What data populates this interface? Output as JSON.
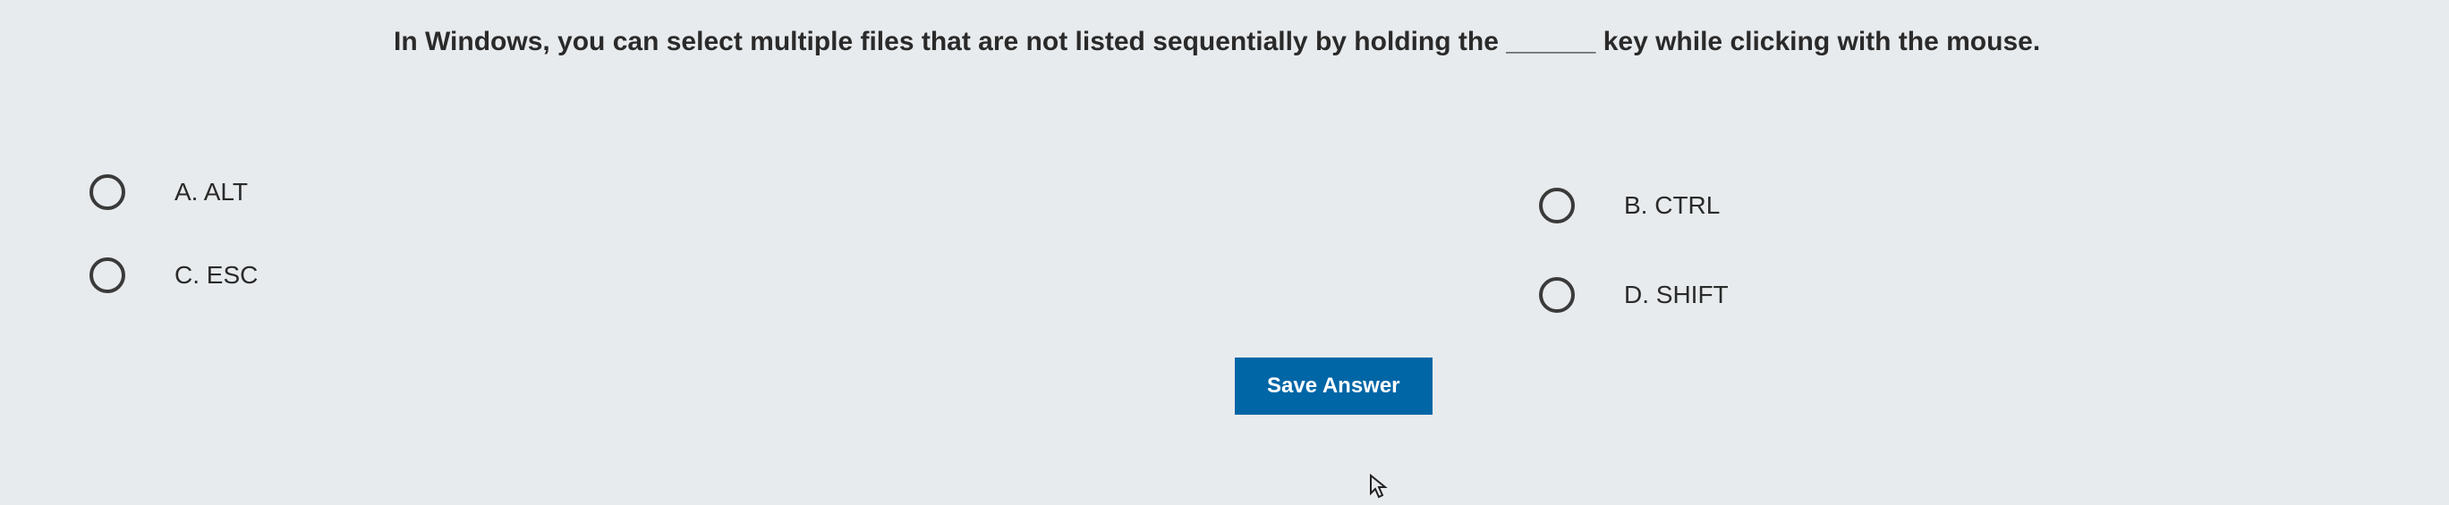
{
  "question": {
    "text": "In Windows, you can select multiple files that are not listed sequentially by holding the ______ key while clicking with the mouse."
  },
  "options": {
    "a": {
      "label": "A. ALT"
    },
    "b": {
      "label": "B. CTRL"
    },
    "c": {
      "label": "C. ESC"
    },
    "d": {
      "label": "D. SHIFT"
    }
  },
  "buttons": {
    "save": "Save Answer"
  }
}
